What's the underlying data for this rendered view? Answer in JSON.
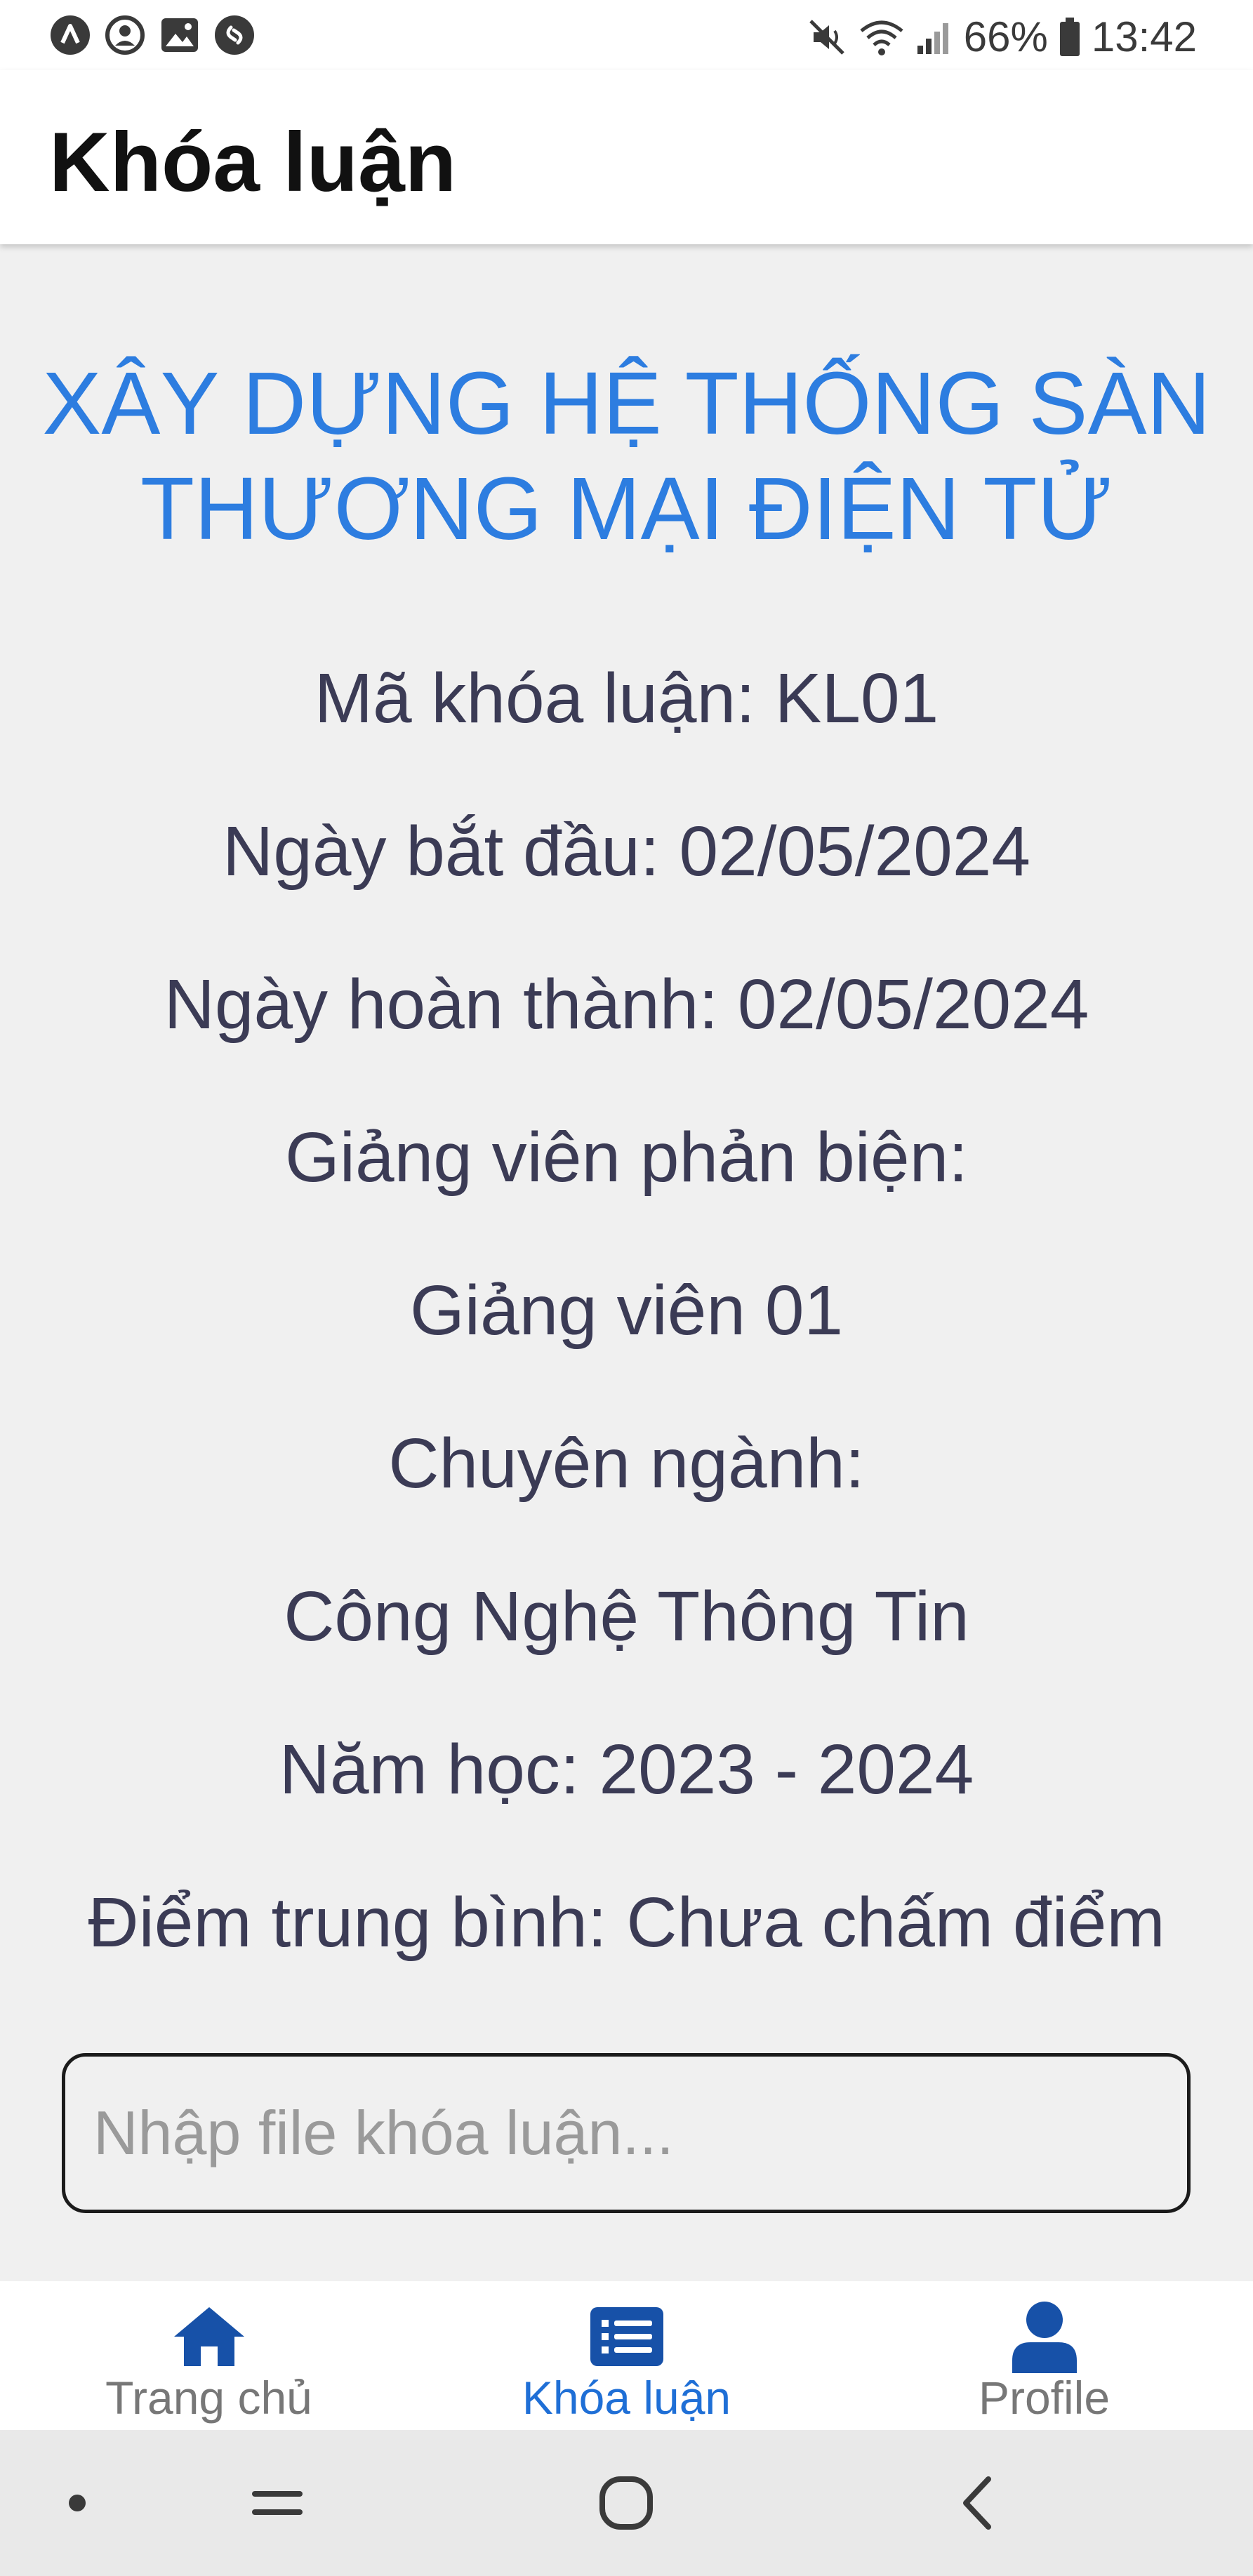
{
  "status_bar": {
    "battery": "66%",
    "time": "13:42",
    "left_icons": [
      "app-icon",
      "account-icon",
      "image-icon",
      "shazam-icon"
    ],
    "right_icons": [
      "mute-icon",
      "wifi-icon",
      "signal-icon",
      "battery-icon"
    ]
  },
  "app_bar": {
    "title": "Khóa luận"
  },
  "thesis": {
    "title_line1": "XÂY DỰNG HỆ THỐNG SÀN",
    "title_line2": "THƯƠNG MẠI ĐIỆN TỬ",
    "lines": [
      "Mã khóa luận: KL01",
      "Ngày bắt đầu: 02/05/2024",
      "Ngày hoàn thành: 02/05/2024",
      "Giảng viên phản biện:",
      "Giảng viên 01",
      "Chuyên ngành:",
      "Công Nghệ Thông Tin",
      "Năm học: 2023 - 2024",
      "Điểm trung bình: Chưa chấm điểm"
    ]
  },
  "file_input": {
    "placeholder": "Nhập file khóa luận...",
    "value": ""
  },
  "bottom_nav": {
    "items": [
      {
        "label": "Trang chủ",
        "icon": "home-icon",
        "active": false
      },
      {
        "label": "Khóa luận",
        "icon": "list-icon",
        "active": true
      },
      {
        "label": "Profile",
        "icon": "person-icon",
        "active": false
      }
    ]
  },
  "system_nav": {
    "buttons": [
      "dot-icon",
      "recent-apps-icon",
      "home-circle-icon",
      "back-icon"
    ]
  },
  "colors": {
    "title_blue": "#2d7de0",
    "nav_active": "#1f6fd6",
    "nav_icon": "#1751a8",
    "text": "#3b3b55"
  }
}
